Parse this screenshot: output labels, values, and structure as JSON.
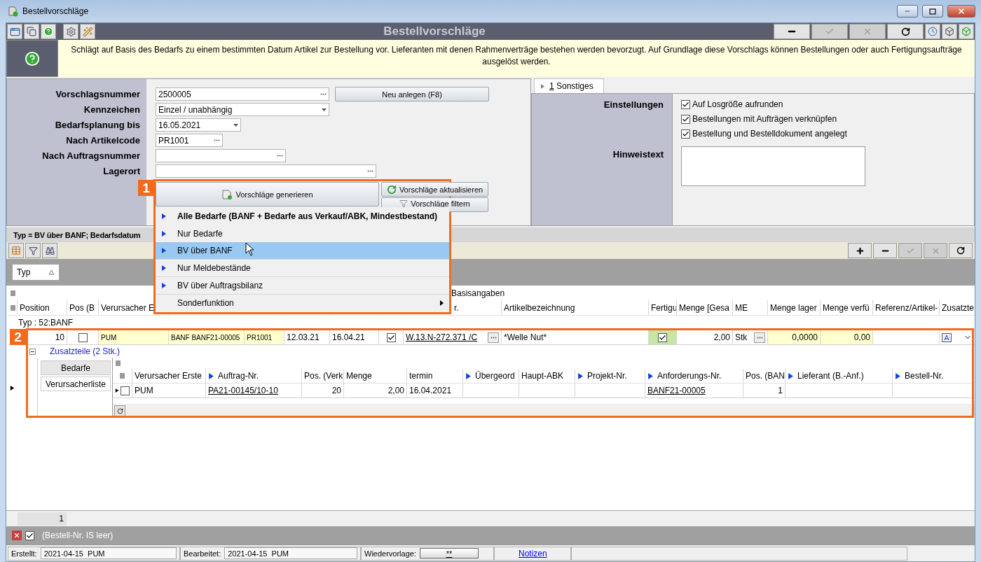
{
  "window": {
    "title": "Bestellvorschläge"
  },
  "toolbar": {
    "title": "Bestellvorschläge"
  },
  "info": {
    "text": "Schlägt auf Basis des Bedarfs zu einem bestimmten Datum Artikel zur Bestellung vor. Lieferanten mit denen Rahmenverträge bestehen werden bevorzugt. Auf Grundlage diese Vorschlags können Bestellungen oder auch Fertigungsaufträge ausgelöst werden."
  },
  "form": {
    "fields": [
      {
        "label": "Vorschlagsnummer",
        "value": "2500005",
        "kind": "lookup"
      },
      {
        "label": "Kennzeichen",
        "value": "Einzel / unabhängig",
        "kind": "select"
      },
      {
        "label": "Bedarfsplanung bis",
        "value": "16.05.2021",
        "kind": "date"
      },
      {
        "label": "Nach Artikelcode",
        "value": "PR1001",
        "kind": "lookup"
      },
      {
        "label": "Nach Auftragsnummer",
        "kind": "lookup"
      },
      {
        "label": "Lagerort",
        "kind": "lookup"
      }
    ],
    "new_button": "Neu anlegen (F8)",
    "generate_button": "Vorschläge generieren",
    "refresh_button": "Vorschläge aktualisieren",
    "filter_button": "Vorschläge filtern"
  },
  "generate_menu": [
    {
      "label": "Alle Bedarfe (BANF + Bedarfe aus Verkauf/ABK, Mindestbestand)",
      "kind": "item",
      "default": true,
      "selected": false
    },
    {
      "label": "Nur Bedarfe",
      "kind": "item",
      "default": false,
      "selected": false
    },
    {
      "label": "BV über BANF",
      "kind": "item",
      "default": false,
      "selected": true
    },
    {
      "label": "Nur Meldebestände",
      "kind": "item",
      "default": false,
      "selected": false
    },
    {
      "label": "BV über Auftragsbilanz",
      "kind": "item",
      "default": false,
      "selected": false
    },
    {
      "label": "Sonderfunktion",
      "kind": "submenu",
      "default": false,
      "selected": false
    }
  ],
  "side_tabs": [
    {
      "label": "1 Sonstiges",
      "selected": true
    }
  ],
  "settings": {
    "label": "Einstellungen",
    "options": [
      {
        "label": "Auf Losgröße aufrunden",
        "checked": true
      },
      {
        "label": "Bestellungen mit Aufträgen verknüpfen",
        "checked": true
      },
      {
        "label": "Bestellung und Bestelldokument angelegt",
        "checked": true
      }
    ],
    "note_label": "Hinweistext"
  },
  "filter_summary": "Typ = BV über BANF; Bedarfsdatum",
  "group_by": [
    {
      "label": "Typ"
    }
  ],
  "grid": {
    "band": "Basisangaben",
    "columns": [
      {
        "label": "Position"
      },
      {
        "label": "Pos (B"
      },
      {
        "label": "Verursacher E"
      },
      {},
      {},
      {},
      {},
      {},
      {
        "label": "r."
      },
      {
        "label": "Artikelbezeichnung"
      },
      {
        "label": "Fertigu"
      },
      {
        "label": "Menge [Gesa"
      },
      {
        "label": "ME"
      },
      {
        "label": "Menge lager"
      },
      {
        "label": "Menge verfü"
      },
      {
        "label": "Referenz/Artikel-"
      },
      {
        "label": "Zusatzte"
      }
    ],
    "group_row": "Typ : 52:BANF",
    "row": [
      {
        "kind": "number",
        "value": "10"
      },
      {
        "kind": "check",
        "checked": false
      },
      {
        "kind": "text",
        "value": "PUM",
        "highlight": true
      },
      {
        "kind": "text",
        "value": "BANF BANF21-00005",
        "highlight": true
      },
      {
        "kind": "text",
        "value": "PR1001",
        "highlight": true
      },
      {
        "kind": "text",
        "value": "12.03.21"
      },
      {
        "kind": "text",
        "value": "16.04.21"
      },
      {
        "kind": "check",
        "checked": true
      },
      {
        "kind": "link",
        "value": "W.13.N-272.371 /C",
        "lookup": true
      },
      {
        "kind": "text",
        "value": "*Welle Nut*"
      },
      {
        "kind": "check",
        "checked": true,
        "color": "#c6e6a6"
      },
      {
        "kind": "number",
        "value": "2,00"
      },
      {
        "kind": "text",
        "value": "Stk",
        "lookup": true
      },
      {
        "kind": "number",
        "value": "0,0000",
        "highlight": true
      },
      {
        "kind": "number",
        "value": "0,00",
        "highlight": true
      },
      {
        "kind": "empty"
      },
      {
        "kind": "icons"
      }
    ],
    "expanded": true,
    "sub_label": "Zusatzteile (2 Stk.)",
    "detail_tabs": [
      {
        "label": "Bedarfe",
        "selected": false
      },
      {
        "label": "Verursacherliste",
        "selected": true
      }
    ],
    "sub_columns": [
      {
        "label": "Verursacher Erste",
        "arrow": false
      },
      {
        "label": "Auftrag-Nr.",
        "arrow": true
      },
      {
        "label": "Pos. (Verk",
        "arrow": false
      },
      {
        "label": "Menge",
        "arrow": false
      },
      {
        "label": "termin",
        "arrow": false
      },
      {
        "label": "Übergeord",
        "arrow": true
      },
      {
        "label": "Haupt-ABK",
        "arrow": false
      },
      {
        "label": "Projekt-Nr.",
        "arrow": true
      },
      {
        "label": "Anforderungs-Nr.",
        "arrow": true
      },
      {
        "label": "Pos. (BAN",
        "arrow": false
      },
      {
        "label": "Lieferant (B.-Anf.)",
        "arrow": true
      },
      {
        "label": "Bestell-Nr.",
        "arrow": true
      }
    ],
    "sub_row": {
      "checked": false,
      "cells": [
        {
          "kind": "text",
          "value": "PUM"
        },
        {
          "kind": "link",
          "value": "PA21-00145/10-10"
        },
        {
          "kind": "number",
          "value": "20"
        },
        {
          "kind": "number",
          "value": "2,00"
        },
        {
          "kind": "text",
          "value": "16.04.2021"
        },
        {
          "kind": "empty"
        },
        {
          "kind": "empty"
        },
        {
          "kind": "empty"
        },
        {
          "kind": "link",
          "value": "BANF21-00005"
        },
        {
          "kind": "number",
          "value": "1"
        },
        {
          "kind": "empty"
        },
        {
          "kind": "empty"
        }
      ]
    },
    "count": "1"
  },
  "filter_bar": {
    "checked": true,
    "text": "(Bestell-Nr. IS leer)"
  },
  "status_bar": {
    "created_label": "Erstellt:",
    "created": "2021-04-15  PUM",
    "edited_label": "Bearbeitet:",
    "edited": "2021-04-15  PUM",
    "resubmit_label": "Wiedervorlage:",
    "resubmit": "**",
    "notes": "Notizen"
  },
  "callouts": [
    {
      "label": "1"
    },
    {
      "label": "2"
    }
  ]
}
